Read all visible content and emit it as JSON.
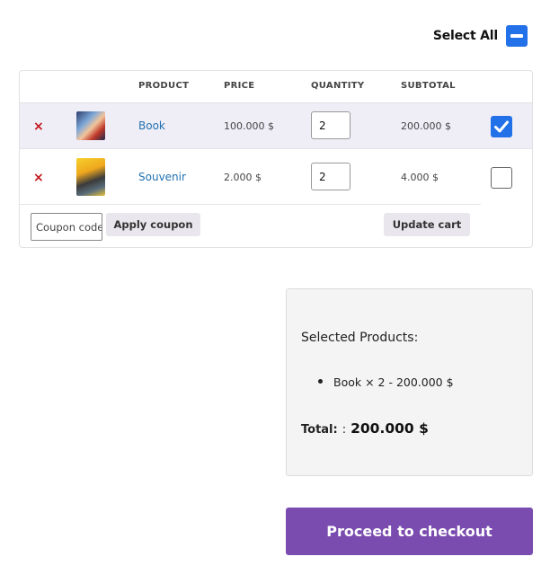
{
  "header": {
    "select_all_label": "Select All"
  },
  "table": {
    "columns": [
      "PRODUCT",
      "PRICE",
      "QUANTITY",
      "SUBTOTAL"
    ],
    "rows": [
      {
        "remove": "×",
        "product": "Book",
        "price": "100.000 $",
        "quantity": "2",
        "subtotal": "200.000 $",
        "selected": true,
        "thumbnail": "book-cover-image"
      },
      {
        "remove": "×",
        "product": "Souvenir",
        "price": "2.000 $",
        "quantity": "2",
        "subtotal": "4.000 $",
        "selected": false,
        "thumbnail": "souvenir-image"
      }
    ]
  },
  "actions": {
    "coupon_placeholder": "Coupon code",
    "apply_label": "Apply coupon",
    "update_label": "Update cart"
  },
  "totals": {
    "heading": "Selected Products:",
    "items": [
      "Book × 2 - 200.000 $"
    ],
    "total_label": "Total:",
    "total_colon": ":",
    "total_value": "200.000 $"
  },
  "checkout": {
    "label": "Proceed to checkout"
  },
  "colors": {
    "accent": "#2271e8",
    "checkout": "#7a4cb0",
    "remove": "#c4151c",
    "link": "#2271b1",
    "selected_row": "#efedf6"
  }
}
